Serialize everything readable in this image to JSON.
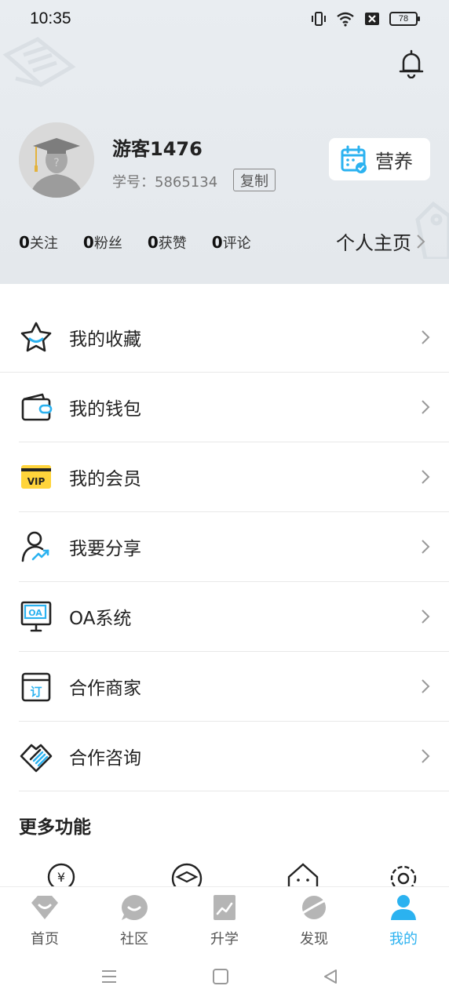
{
  "status_bar": {
    "time": "10:35",
    "battery": "78"
  },
  "profile": {
    "username": "游客1476",
    "student_id": "学号：5865134",
    "copy_label": "复制",
    "nutrition_label": "营养",
    "profile_link": "个人主页"
  },
  "stats": [
    {
      "count": "0",
      "label": "关注"
    },
    {
      "count": "0",
      "label": "粉丝"
    },
    {
      "count": "0",
      "label": "获赞"
    },
    {
      "count": "0",
      "label": "评论"
    }
  ],
  "menu": [
    {
      "label": "我的收藏",
      "icon": "star-icon"
    },
    {
      "label": "我的钱包",
      "icon": "wallet-icon"
    },
    {
      "label": "我的会员",
      "icon": "vip-icon"
    },
    {
      "label": "我要分享",
      "icon": "share-user-icon"
    },
    {
      "label": "OA系统",
      "icon": "oa-monitor-icon"
    },
    {
      "label": "合作商家",
      "icon": "merchant-calendar-icon"
    },
    {
      "label": "合作咨询",
      "icon": "handshake-icon"
    }
  ],
  "more": {
    "title": "更多功能"
  },
  "tabs": [
    {
      "label": "首页",
      "icon": "home-diamond-icon"
    },
    {
      "label": "社区",
      "icon": "chat-bubble-icon"
    },
    {
      "label": "升学",
      "icon": "chart-book-icon"
    },
    {
      "label": "发现",
      "icon": "planet-icon"
    },
    {
      "label": "我的",
      "icon": "person-icon"
    }
  ],
  "colors": {
    "accent": "#2bb2f0",
    "vip_yellow": "#ffd43b",
    "header_bg": "#e7ebef"
  }
}
